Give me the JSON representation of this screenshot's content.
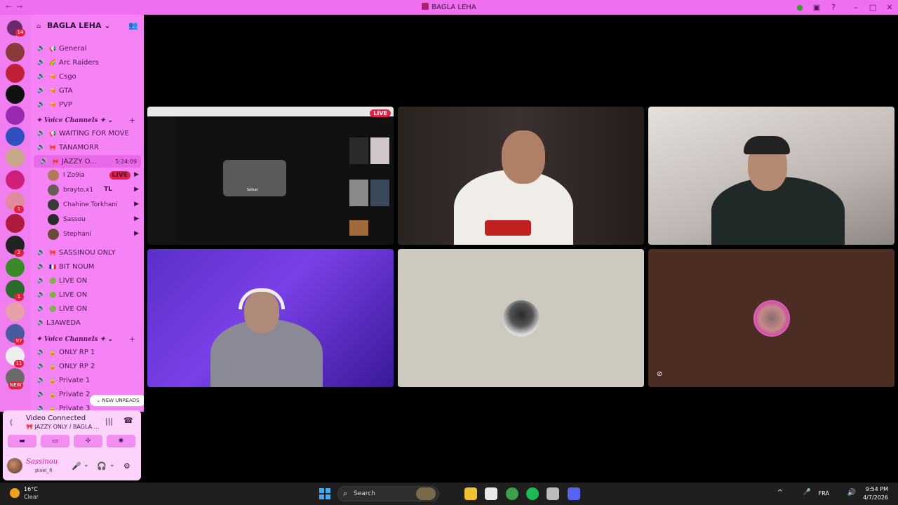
{
  "window": {
    "title": "BAGLA LEHA",
    "back_icon": "arrow-left",
    "forward_icon": "arrow-right",
    "right_icons": [
      "inbox-icon",
      "help-icon"
    ],
    "controls": [
      "minimize",
      "maximize",
      "close"
    ]
  },
  "rail": {
    "dm_badge": "14",
    "servers": [
      {
        "badge": "",
        "color": "#8a3a3a"
      },
      {
        "badge": "",
        "color": "#c0203a"
      },
      {
        "badge": "",
        "color": "#111111"
      },
      {
        "badge": "",
        "color": "#9a2ab0"
      },
      {
        "badge": "",
        "color": "#3050c0"
      },
      {
        "badge": "",
        "color": "#c8a68a"
      },
      {
        "badge": "",
        "color": "#d0207a"
      },
      {
        "badge": "1",
        "color": "#e08a9a"
      },
      {
        "badge": "",
        "color": "#b01a40"
      },
      {
        "badge": "2",
        "color": "#222222"
      },
      {
        "badge": "",
        "color": "#3a8a2a"
      },
      {
        "badge": "1",
        "color": "#2a6a2a"
      },
      {
        "badge": "",
        "color": "#e8a0a8"
      },
      {
        "badge": "97",
        "color": "#4a5aa0"
      },
      {
        "badge": "11",
        "color": "#eeeeee"
      },
      {
        "badge": "NEW",
        "color": "#6a6a6a"
      }
    ]
  },
  "sidebar": {
    "server_name": "BAGLA LEHA",
    "text_channels": [
      {
        "emoji": "📢",
        "name": "General"
      },
      {
        "emoji": "🌈",
        "name": "Arc Raiders"
      },
      {
        "emoji": "🔫",
        "name": "Csgo"
      },
      {
        "emoji": "🔫",
        "name": "GTA"
      },
      {
        "emoji": "🔫",
        "name": "PVP"
      }
    ],
    "category1": "Voice Channels",
    "voice_channels": [
      {
        "emoji": "📢",
        "name": "WAITING FOR MOVE"
      },
      {
        "emoji": "🎀",
        "name": "TANAMORR"
      },
      {
        "emoji": "🎀",
        "name": "JAZZY O...",
        "timer": "5:24:09"
      }
    ],
    "voice_users": [
      {
        "name": "I Zo9ia",
        "live": "LIVE",
        "color": "#b07a5a"
      },
      {
        "name": "brayto.x1",
        "tag": "TL",
        "color": "#6a5a5a"
      },
      {
        "name": "Chahine Torkhani",
        "color": "#3a3a3a"
      },
      {
        "name": "Sassou",
        "color": "#2a2a2a"
      },
      {
        "name": "Stephani",
        "color": "#6a4a3a"
      }
    ],
    "voice_channels2": [
      {
        "emoji": "🎀",
        "name": "SASSINOU ONLY"
      },
      {
        "emoji": "🇫🇷",
        "name": "BIT NOUM"
      },
      {
        "emoji": "🟢",
        "name": "LIVE ON"
      },
      {
        "emoji": "🟢",
        "name": "LIVE ON"
      },
      {
        "emoji": "🟢",
        "name": "LIVE ON"
      },
      {
        "emoji": "",
        "name": "L3AWEDA"
      }
    ],
    "category2": "Voice Channels",
    "voice_channels3": [
      {
        "emoji": "🔒",
        "name": "ONLY RP 1"
      },
      {
        "emoji": "🔒",
        "name": "ONLY RP 2"
      },
      {
        "emoji": "🔒",
        "name": "Private 1"
      },
      {
        "emoji": "🔒",
        "name": "Private 2"
      },
      {
        "emoji": "🔒",
        "name": "Private 3"
      }
    ],
    "new_unreads": "NEW UNREADS"
  },
  "voice_panel": {
    "status": "Video Connected",
    "channel": "JAZZY ONLY / BAGLA ..."
  },
  "user": {
    "name": "Sassinou",
    "status": "pixel_fi"
  },
  "stage": {
    "tiles": [
      {
        "id": "stream",
        "live_label": "LIVE",
        "stream_caption": "Selkat"
      },
      {
        "id": "cam1"
      },
      {
        "id": "cam2"
      },
      {
        "id": "cam3"
      },
      {
        "id": "avatar1"
      },
      {
        "id": "avatar2"
      }
    ]
  },
  "taskbar": {
    "temperature": "16°C",
    "weather": "Clear",
    "search_placeholder": "Search",
    "language": "FRA",
    "time": "9:54 PM",
    "date": "4/7/2026",
    "apps": [
      {
        "name": "file-explorer",
        "color": "#f0c030"
      },
      {
        "name": "store",
        "color": "#e8e8e8"
      },
      {
        "name": "chrome",
        "color": "#3aa04a"
      },
      {
        "name": "spotify",
        "color": "#1db954"
      },
      {
        "name": "steam",
        "color": "#bbbbbb"
      },
      {
        "name": "discord",
        "color": "#5865f2"
      }
    ]
  }
}
